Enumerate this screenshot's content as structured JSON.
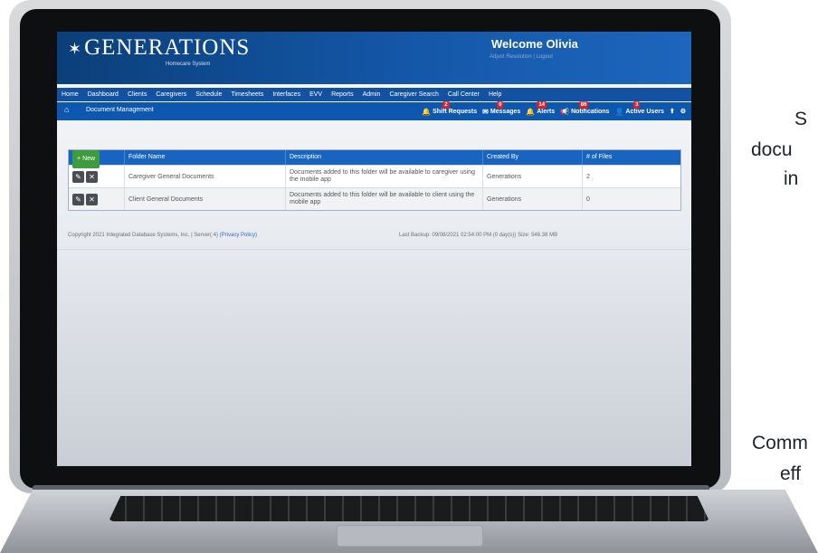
{
  "app": {
    "logo_text": "GENERATIONS",
    "logo_subtitle": "Homecare System",
    "welcome": "Welcome Olivia",
    "welcome_links": "Adjust Resolution | Logout"
  },
  "nav": {
    "items": [
      "Home",
      "Dashboard",
      "Clients",
      "Caregivers",
      "Schedule",
      "Timesheets",
      "Interfaces",
      "EVV",
      "Reports",
      "Admin",
      "Caregiver Search",
      "Call Center",
      "Help"
    ]
  },
  "subbar": {
    "breadcrumb": "Document Management",
    "alerts": [
      {
        "label": "Shift Requests",
        "count": "2",
        "icon": "bell-icon"
      },
      {
        "label": "Messages",
        "count": "0",
        "icon": "envelope-icon"
      },
      {
        "label": "Alerts",
        "count": "14",
        "icon": "bell-icon"
      },
      {
        "label": "Notifications",
        "count": "86",
        "icon": "megaphone-icon"
      },
      {
        "label": "Active Users",
        "count": "3",
        "icon": "user-icon"
      }
    ]
  },
  "table": {
    "new_label": "New",
    "headers": [
      "Folder Name",
      "Description",
      "Created By",
      "# of Files"
    ],
    "rows": [
      {
        "folder": "Caregiver General Documents",
        "description": "Documents added to this folder will be available to caregiver using the mobile app",
        "created_by": "Generations",
        "files": "2"
      },
      {
        "folder": "Client General Documents",
        "description": "Documents added to this folder will be available to client using the mobile app",
        "created_by": "Generations",
        "files": "0"
      }
    ]
  },
  "footer": {
    "copyright": "Copyright 2021 Integrated Database Systems, Inc. | Server(.4)",
    "privacy": "(Privacy Policy)",
    "backup": "Last Backup: 09/08/2021 02:54:00 PM (0 day(s)) Size: 546.38 MB"
  },
  "side_text": {
    "line1": "S",
    "line2": "docu",
    "line3": "in",
    "line4": "Comm",
    "line5": "eff"
  }
}
